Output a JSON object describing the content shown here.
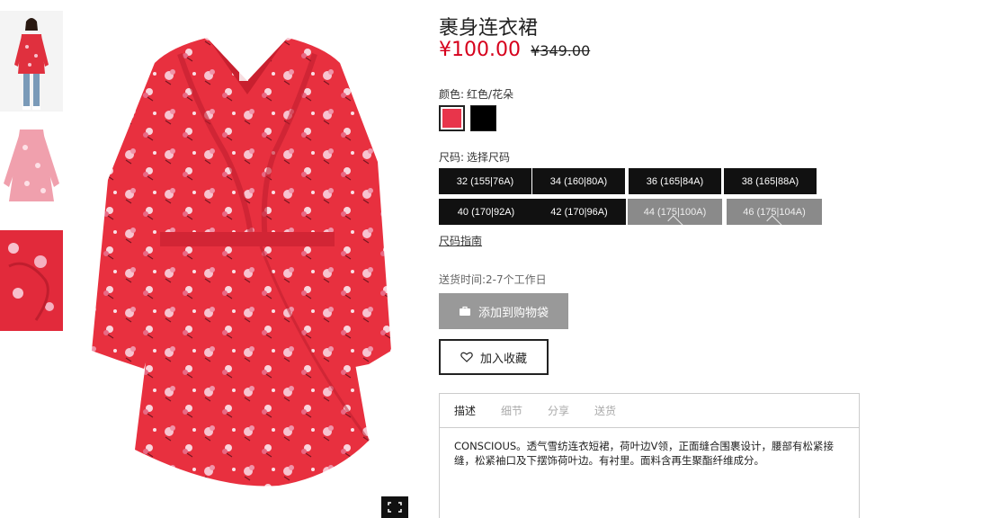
{
  "product": {
    "title": "裹身连衣裙",
    "price_now": "¥100.00",
    "price_old": "¥349.00"
  },
  "color": {
    "label": "颜色:",
    "value": "红色/花朵",
    "swatches": [
      {
        "name": "red-floral",
        "hex": "#e8354b",
        "selected": true
      },
      {
        "name": "black",
        "hex": "#000000",
        "selected": false
      }
    ]
  },
  "size": {
    "label": "尺码:",
    "value": "选择尺码",
    "options": [
      {
        "label": "32 (155|76A)",
        "available": true
      },
      {
        "label": "34 (160|80A)",
        "available": true
      },
      {
        "label": "36 (165|84A)",
        "available": true
      },
      {
        "label": "38 (165|88A)",
        "available": true
      },
      {
        "label": "40 (170|92A)",
        "available": true
      },
      {
        "label": "42 (170|96A)",
        "available": true
      },
      {
        "label": "44 (175|100A)",
        "available": false
      },
      {
        "label": "46 (175|104A)",
        "available": false
      }
    ],
    "guide_label": "尺码指南"
  },
  "delivery_text": "送货时间:2-7个工作日",
  "actions": {
    "add_to_bag": "添加到购物袋",
    "favorite": "加入收藏"
  },
  "tabs": [
    {
      "label": "描述",
      "active": true
    },
    {
      "label": "细节",
      "active": false
    },
    {
      "label": "分享",
      "active": false
    },
    {
      "label": "送货",
      "active": false
    }
  ],
  "description": "CONSCIOUS。透气雪纺连衣短裙，荷叶边V领，正面缝合围裹设计，腰部有松紧接缝，松紧袖口及下摆饰荷叶边。有衬里。面料含再生聚酯纤维成分。",
  "colors": {
    "price_red": "#d6001c",
    "dress_red": "#e8303f",
    "button_black": "#111111",
    "button_disabled": "#8a8a8a"
  },
  "icons": [
    "bag-icon",
    "heart-icon",
    "fullscreen-icon"
  ]
}
